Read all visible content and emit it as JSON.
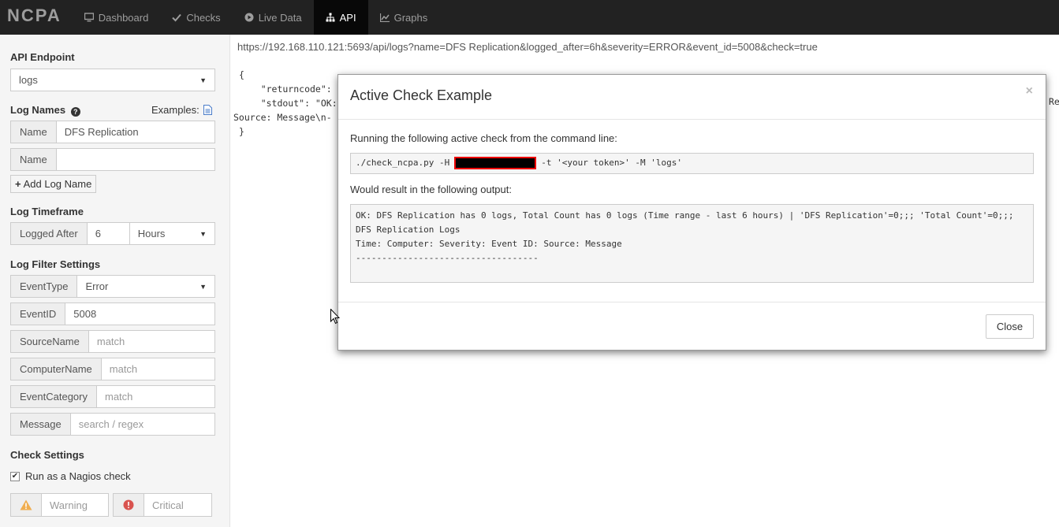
{
  "navbar": {
    "brand": "NCPA",
    "items": [
      {
        "label": "Dashboard",
        "icon": "monitor-icon"
      },
      {
        "label": "Checks",
        "icon": "check-icon"
      },
      {
        "label": "Live Data",
        "icon": "play-icon"
      },
      {
        "label": "API",
        "icon": "sitemap-icon"
      },
      {
        "label": "Graphs",
        "icon": "chart-icon"
      }
    ]
  },
  "sidebar": {
    "api_endpoint_title": "API Endpoint",
    "api_endpoint_value": "logs",
    "log_names_title": "Log Names",
    "examples_label": "Examples:",
    "name_label": "Name",
    "name_1_value": "DFS Replication",
    "name_2_value": "",
    "add_log_name_label": "Add Log Name",
    "log_timeframe_title": "Log Timeframe",
    "logged_after_label": "Logged After",
    "logged_after_value": "6",
    "logged_after_unit": "Hours",
    "filter_title": "Log Filter Settings",
    "event_type_label": "EventType",
    "event_type_value": "Error",
    "event_id_label": "EventID",
    "event_id_value": "5008",
    "source_name_label": "SourceName",
    "source_name_placeholder": "match",
    "computer_name_label": "ComputerName",
    "computer_name_placeholder": "match",
    "event_category_label": "EventCategory",
    "event_category_placeholder": "match",
    "message_label": "Message",
    "message_placeholder": "search / regex",
    "check_settings_title": "Check Settings",
    "run_as_nagios_label": "Run as a Nagios check",
    "warning_placeholder": "Warning",
    "critical_placeholder": "Critical"
  },
  "main": {
    "url": "https://192.168.110.121:5693/api/logs?name=DFS Replication&logged_after=6h&severity=ERROR&event_id=5008&check=true",
    "json_open": "{",
    "json_returncode": "    \"returncode\":",
    "json_stdout": "    \"stdout\": \"OK:",
    "json_source": "Source: Message\\n-",
    "json_close": "}",
    "json_right_fragment": "Re"
  },
  "modal": {
    "title": "Active Check Example",
    "close_x": "×",
    "intro": "Running the following active check from the command line:",
    "cmd_prefix": "./check_ncpa.py -H",
    "cmd_suffix": "-t '<your token>' -M 'logs'",
    "result_intro": "Would result in the following output:",
    "output_line1": "OK: DFS Replication has 0 logs, Total Count has 0 logs (Time range - last 6 hours) | 'DFS Replication'=0;;; 'Total Count'=0;;;",
    "output_line2": "DFS Replication Logs",
    "output_line3": "Time: Computer: Severity: Event ID: Source: Message",
    "output_line4": "-----------------------------------",
    "close_button": "Close"
  }
}
